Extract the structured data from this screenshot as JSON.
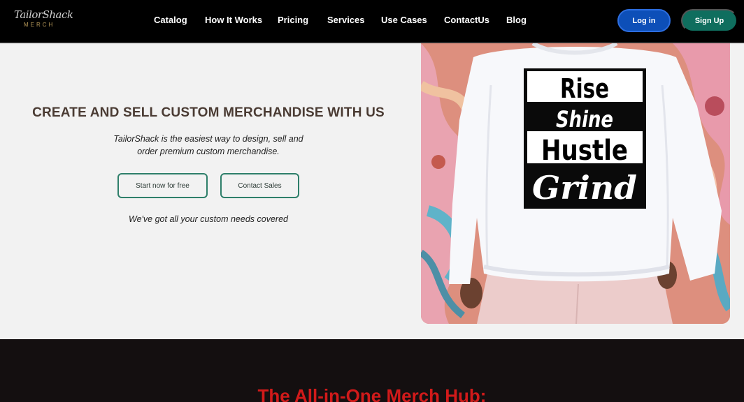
{
  "header": {
    "logo_script": "TailorShack",
    "logo_sub": "MERCH",
    "nav": [
      "Catalog",
      "How It Works",
      "Pricing",
      "Services",
      "Use Cases",
      "ContactUs",
      "Blog"
    ],
    "login_label": "Log in",
    "signup_label": "Sign Up"
  },
  "hero": {
    "title": "CREATE AND SELL CUSTOM MERCHANDISE WITH US",
    "subtitle": "TailorShack is the easiest way to design, sell and order premium custom merchandise.",
    "start_label": "Start now for free",
    "contact_label": "Contact Sales",
    "tagline": "We've got all your custom needs covered"
  },
  "shirt_print": {
    "line1": "Rise",
    "line2": "Shine",
    "line3": "Hustle",
    "line4": "Grind"
  },
  "section": {
    "title": "The All-in-One Merch Hub:"
  },
  "colors": {
    "nav_bg": "#000000",
    "login_bg": "#0d4fb8",
    "signup_bg": "#0f6e5e",
    "hero_bg": "#f2f2f2",
    "outline_accent": "#2e7f6a",
    "dark_section_bg": "#140f10",
    "section_title": "#d11a1a"
  }
}
